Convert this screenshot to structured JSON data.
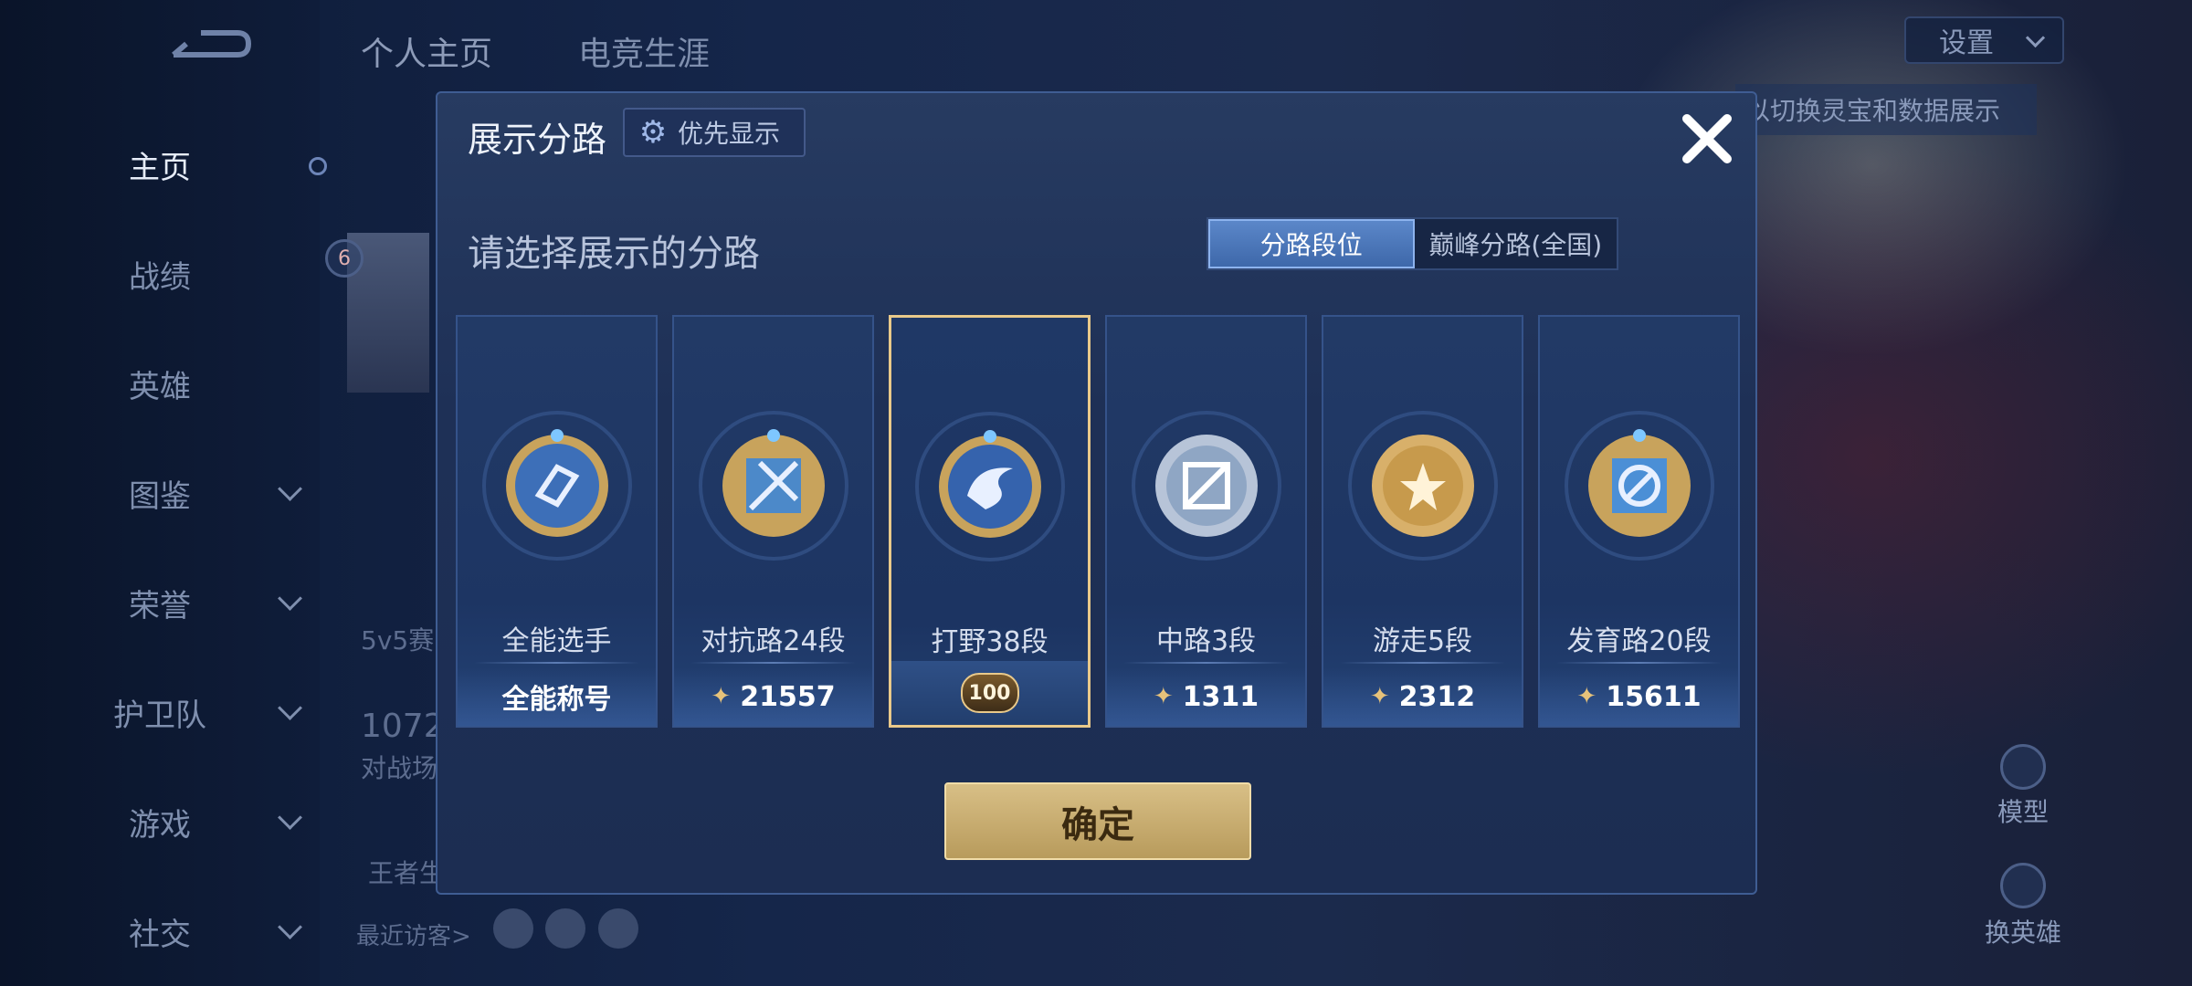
{
  "sidebar": {
    "items": [
      {
        "label": "主页",
        "active": true,
        "chevron": false
      },
      {
        "label": "战绩",
        "active": false,
        "chevron": false
      },
      {
        "label": "英雄",
        "active": false,
        "chevron": false
      },
      {
        "label": "图鉴",
        "active": false,
        "chevron": true
      },
      {
        "label": "荣誉",
        "active": false,
        "chevron": true
      },
      {
        "label": "护卫队",
        "active": false,
        "chevron": true
      },
      {
        "label": "游戏",
        "active": false,
        "chevron": true
      },
      {
        "label": "社交",
        "active": false,
        "chevron": true
      }
    ]
  },
  "top_tabs": [
    "个人主页",
    "电竞生涯"
  ],
  "settings": {
    "label": "设置"
  },
  "background": {
    "hint": "以切换灵宝和数据展示",
    "level_badge": "6",
    "match_label": "5v5赛",
    "count": "1072",
    "battle_label": "对战场",
    "king_label": "王者生",
    "recent_visitors": "最近访客>",
    "model_label": "模型",
    "switch_hero_label": "换英雄"
  },
  "modal": {
    "title": "展示分路",
    "priority_button": "优先显示",
    "subtitle": "请选择展示的分路",
    "segment": {
      "options": [
        "分路段位",
        "巅峰分路(全国)"
      ],
      "selected": 0
    },
    "cards": [
      {
        "name": "全能选手",
        "foot": "全能称号",
        "score_icon": false,
        "emblem_color": "#3d6fb8",
        "selected": false
      },
      {
        "name": "对抗路24段",
        "foot": "21557",
        "score_icon": true,
        "emblem_color": "#4c89c9",
        "selected": false
      },
      {
        "name": "打野38段",
        "foot": "",
        "badge": "100",
        "score_icon": false,
        "emblem_color": "#3563ad",
        "selected": true
      },
      {
        "name": "中路3段",
        "foot": "1311",
        "score_icon": true,
        "emblem_color": "#8fa6c4",
        "selected": false
      },
      {
        "name": "游走5段",
        "foot": "2312",
        "score_icon": true,
        "emblem_color": "#c79a4c",
        "selected": false
      },
      {
        "name": "发育路20段",
        "foot": "15611",
        "score_icon": true,
        "emblem_color": "#4b8fd6",
        "selected": false
      }
    ],
    "confirm": "确定"
  },
  "colors": {
    "accent_gold": "#e9c98a",
    "panel": "#1e3056",
    "segment_on": "#4a77bb"
  }
}
